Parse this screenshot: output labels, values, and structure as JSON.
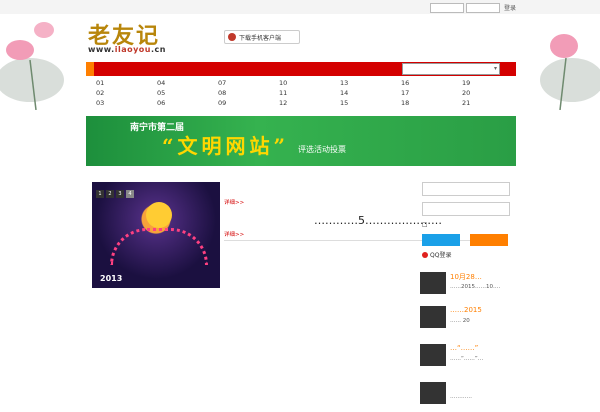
{
  "topbar": {
    "text": "",
    "login_label": "登录"
  },
  "logo": {
    "main": "老友记",
    "url_prefix": "www.",
    "url_accent": "ilaoyou",
    "url_suffix": ".cn"
  },
  "header": {
    "site_tag": "",
    "download_label": "下载手机客户端"
  },
  "menu": {
    "items": [
      {
        "num": "01",
        "label": "",
        "active": true
      },
      {
        "num": "02",
        "label": ""
      },
      {
        "num": "03",
        "label": ""
      },
      {
        "num": "04",
        "label": ""
      },
      {
        "num": "05",
        "label": ""
      },
      {
        "num": "06",
        "label": ""
      },
      {
        "num": "07",
        "label": ""
      },
      {
        "num": "08",
        "label": ""
      },
      {
        "num": "09",
        "label": ""
      },
      {
        "num": "10",
        "label": ""
      },
      {
        "num": "11",
        "label": ""
      },
      {
        "num": "12",
        "label": ""
      },
      {
        "num": "13",
        "label": ""
      },
      {
        "num": "14",
        "label": ""
      },
      {
        "num": "15",
        "label": ""
      },
      {
        "num": "16",
        "label": ""
      },
      {
        "num": "17",
        "label": ""
      },
      {
        "num": "18",
        "label": ""
      },
      {
        "num": "19",
        "label": ""
      },
      {
        "num": "20",
        "label": ""
      },
      {
        "num": "21",
        "label": ""
      }
    ]
  },
  "banner": {
    "left": "南宁市第二届",
    "main": "“文明网站”",
    "sub": "评选活动投票",
    "right": ""
  },
  "slider": {
    "pages": [
      "1",
      "2",
      "3",
      "4"
    ],
    "year": "2013"
  },
  "news": {
    "top_more": "详细>>",
    "headline": "…………5…………………",
    "sub_more": "详细>>"
  },
  "right_col": {
    "qq_label": "QQ登录",
    "thumbs": [
      {
        "title": "10月28…",
        "desc": "……2015……10……28"
      },
      {
        "title": "……2015",
        "desc": "…… 20"
      },
      {
        "title": "…“……”",
        "desc": "……“……”…"
      },
      {
        "title": "",
        "desc": "…………"
      }
    ]
  },
  "colors": {
    "nav_red": "#d40000",
    "accent_orange": "#ff7f00",
    "banner_green": "#35b24f",
    "qq_blue": "#1aa0e8"
  }
}
